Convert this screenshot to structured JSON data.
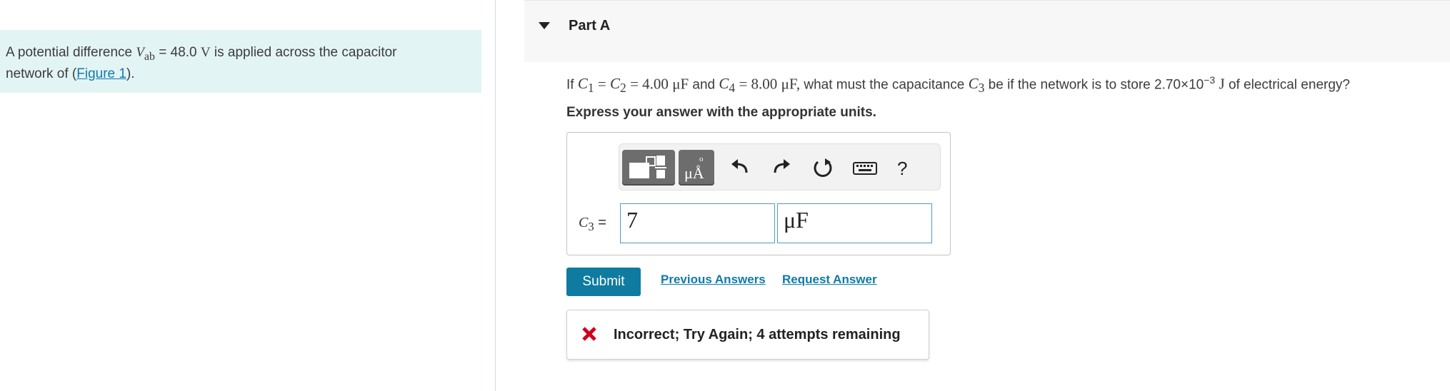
{
  "problem": {
    "text_before": "A potential difference",
    "var": "V",
    "var_sub": "ab",
    "equals": "= 48.0",
    "unit": "V",
    "text_after": "is applied across the capacitor",
    "line2_before": "network of (",
    "figure_link": "Figure 1",
    "line2_after": ")."
  },
  "part": {
    "title": "Part A"
  },
  "question": {
    "if": "If",
    "c1": "C",
    "c1_sub": "1",
    "c2": "C",
    "c2_sub": "2",
    "eq1": "=",
    "eq2": "= 4.00",
    "mu_unit": "μF",
    "and": "and",
    "c4": "C",
    "c4_sub": "4",
    "eq3": "= 8.00",
    "mu_unit2": "μF,",
    "middle": "what must the capacitance",
    "c3": "C",
    "c3_sub": "3",
    "end_before": "be if the network is to store 2.70×10",
    "exponent": "−3",
    "energy_unit": "J",
    "end_after": "of electrical energy?"
  },
  "instruction": "Express your answer with the appropriate units.",
  "answer": {
    "label_var": "C",
    "label_sub": "3",
    "label_eq": "=",
    "value": "7",
    "unit": "μF"
  },
  "toolbar": {
    "units_glyph_top": "o",
    "units_glyph": "μÅ",
    "help": "?"
  },
  "actions": {
    "submit": "Submit",
    "previous_answers": "Previous Answers",
    "request_answer": "Request Answer"
  },
  "feedback": {
    "message": "Incorrect; Try Again; 4 attempts remaining",
    "status_color": "#d0021b"
  }
}
